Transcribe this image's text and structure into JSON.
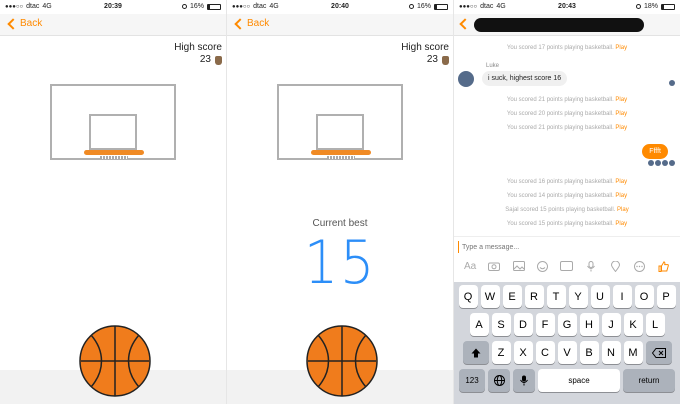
{
  "panel1": {
    "status": {
      "carrier": "dtac",
      "network": "4G",
      "time": "20:39",
      "battery": "16%"
    },
    "nav": {
      "back_label": "Back"
    },
    "high_score": {
      "label": "High score",
      "value": "23"
    }
  },
  "panel2": {
    "status": {
      "carrier": "dtac",
      "network": "4G",
      "time": "20:40",
      "battery": "16%"
    },
    "nav": {
      "back_label": "Back"
    },
    "high_score": {
      "label": "High score",
      "value": "23"
    },
    "current_best_label": "Current best",
    "current_best_value": "15"
  },
  "panel3": {
    "status": {
      "carrier": "dtac",
      "network": "4G",
      "time": "20:43",
      "battery": "18%"
    },
    "messages": [
      {
        "text": "You scored 17 points playing basketball.",
        "action": "Play"
      },
      {
        "sender": "Luke",
        "bubble": "i suck, highest score 16"
      },
      {
        "text": "You scored 21 points playing basketball.",
        "action": "Play"
      },
      {
        "text": "You scored 20 points playing basketball.",
        "action": "Play"
      },
      {
        "text": "You scored 21 points playing basketball.",
        "action": "Play"
      },
      {
        "outgoing": "Fffft"
      },
      {
        "text": "You scored 16 points playing basketball.",
        "action": "Play"
      },
      {
        "text": "You scored 14 points playing basketball.",
        "action": "Play"
      },
      {
        "text": "Sajal scored 15 points playing basketball.",
        "action": "Play"
      },
      {
        "text": "You scored 15 points playing basketball.",
        "action": "Play"
      }
    ],
    "composer": {
      "placeholder": "Type a message..."
    },
    "tools": [
      "Aa",
      "camera-icon",
      "photo-icon",
      "smiley-icon",
      "gif-icon",
      "mic-icon",
      "location-icon",
      "more-icon",
      "like-icon"
    ],
    "keyboard": {
      "row1": [
        "Q",
        "W",
        "E",
        "R",
        "T",
        "Y",
        "U",
        "I",
        "O",
        "P"
      ],
      "row2": [
        "A",
        "S",
        "D",
        "F",
        "G",
        "H",
        "J",
        "K",
        "L"
      ],
      "row3": [
        "Z",
        "X",
        "C",
        "V",
        "B",
        "N",
        "M"
      ],
      "numbers_label": "123",
      "space_label": "space",
      "return_label": "return"
    }
  },
  "colors": {
    "accent": "#ff8a00",
    "score_blue": "#2c8ef8",
    "ball": "#f07c1c"
  }
}
